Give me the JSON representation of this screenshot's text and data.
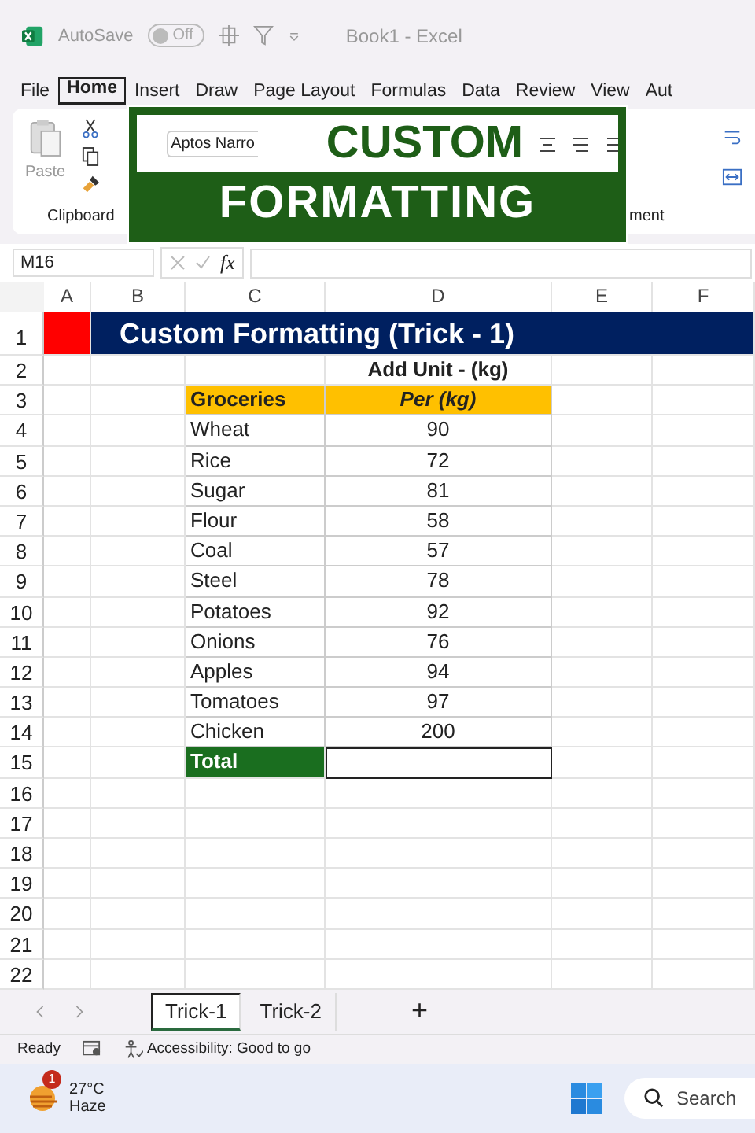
{
  "title_bar": {
    "autosave_label": "AutoSave",
    "autosave_toggle": {
      "label": "Off",
      "on": false
    },
    "document_title": "Book1  -  Excel"
  },
  "menu_tabs": [
    {
      "label": "File",
      "selected": false
    },
    {
      "label": "Home",
      "selected": true
    },
    {
      "label": "Insert",
      "selected": false
    },
    {
      "label": "Draw",
      "selected": false
    },
    {
      "label": "Page Layout",
      "selected": false
    },
    {
      "label": "Formulas",
      "selected": false
    },
    {
      "label": "Data",
      "selected": false
    },
    {
      "label": "Review",
      "selected": false
    },
    {
      "label": "View",
      "selected": false
    },
    {
      "label": "Aut",
      "selected": false
    }
  ],
  "ribbon": {
    "paste_label": "Paste",
    "font_name": "Aptos Narro",
    "clipboard_label": "Clipboard",
    "alignment_label_visible": "ment"
  },
  "banner": {
    "line_1": "CUSTOM",
    "line_2": "FORMATTING"
  },
  "formula_bar": {
    "name_box": "M16",
    "function_label": "fx"
  },
  "sheet": {
    "columns": [
      "A",
      "B",
      "C",
      "D",
      "E",
      "F"
    ],
    "row_numbers": [
      "1",
      "2",
      "3",
      "4",
      "5",
      "6",
      "7",
      "8",
      "9",
      "10",
      "11",
      "12",
      "13",
      "14",
      "15",
      "16",
      "17",
      "18",
      "19",
      "20",
      "21",
      "22"
    ],
    "title": "Custom Formatting (Trick - 1)",
    "subtitle": "Add Unit - (kg)",
    "headers": [
      "Groceries",
      "Per (kg)"
    ],
    "items": [
      {
        "name": "Wheat",
        "value": "90"
      },
      {
        "name": "Rice",
        "value": "72"
      },
      {
        "name": "Sugar",
        "value": "81"
      },
      {
        "name": "Flour",
        "value": "58"
      },
      {
        "name": "Coal",
        "value": "57"
      },
      {
        "name": "Steel",
        "value": "78"
      },
      {
        "name": "Potatoes",
        "value": "92"
      },
      {
        "name": "Onions",
        "value": "76"
      },
      {
        "name": "Apples",
        "value": "94"
      },
      {
        "name": "Tomatoes",
        "value": "97"
      },
      {
        "name": "Chicken",
        "value": "200"
      }
    ],
    "total_label": "Total"
  },
  "sheet_tabs": [
    {
      "label": "Trick-1",
      "selected": true
    },
    {
      "label": "Trick-2",
      "selected": false
    }
  ],
  "add_sheet": "+",
  "status_bar": {
    "ready": "Ready",
    "accessibility": "Accessibility: Good to go"
  },
  "taskbar": {
    "weather_badge": "1",
    "temperature": "27°C",
    "condition": "Haze",
    "search_label": "Search"
  }
}
